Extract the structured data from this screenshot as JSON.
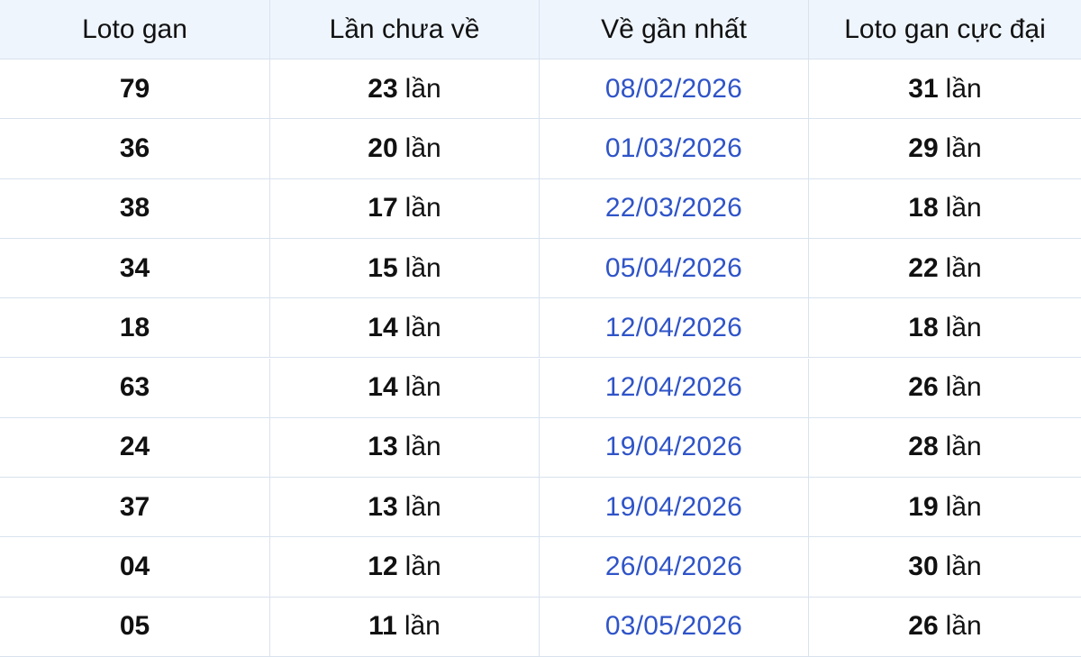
{
  "table": {
    "headers": [
      "Loto gan",
      "Lần chưa về",
      "Về gần nhất",
      "Loto gan cực đại"
    ],
    "unit": "lần",
    "rows": [
      {
        "loto": "79",
        "chua_ve": "23",
        "ve_gan_nhat": "08/02/2026",
        "cuc_dai": "31"
      },
      {
        "loto": "36",
        "chua_ve": "20",
        "ve_gan_nhat": "01/03/2026",
        "cuc_dai": "29"
      },
      {
        "loto": "38",
        "chua_ve": "17",
        "ve_gan_nhat": "22/03/2026",
        "cuc_dai": "18"
      },
      {
        "loto": "34",
        "chua_ve": "15",
        "ve_gan_nhat": "05/04/2026",
        "cuc_dai": "22"
      },
      {
        "loto": "18",
        "chua_ve": "14",
        "ve_gan_nhat": "12/04/2026",
        "cuc_dai": "18"
      },
      {
        "loto": "63",
        "chua_ve": "14",
        "ve_gan_nhat": "12/04/2026",
        "cuc_dai": "26"
      },
      {
        "loto": "24",
        "chua_ve": "13",
        "ve_gan_nhat": "19/04/2026",
        "cuc_dai": "28"
      },
      {
        "loto": "37",
        "chua_ve": "13",
        "ve_gan_nhat": "19/04/2026",
        "cuc_dai": "19"
      },
      {
        "loto": "04",
        "chua_ve": "12",
        "ve_gan_nhat": "26/04/2026",
        "cuc_dai": "30"
      },
      {
        "loto": "05",
        "chua_ve": "11",
        "ve_gan_nhat": "03/05/2026",
        "cuc_dai": "26"
      }
    ]
  },
  "colors": {
    "header_bg": "#eef5fd",
    "grid_line": "#d9e2ee",
    "date_text": "#2f54c8",
    "text": "#111111"
  }
}
